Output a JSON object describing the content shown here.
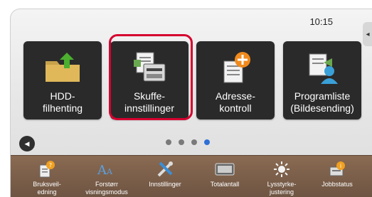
{
  "clock": "10:15",
  "tiles": [
    {
      "label": "HDD-\nfilhenting"
    },
    {
      "label": "Skuffe-\ninnstillinger"
    },
    {
      "label": "Adresse-\nkontroll"
    },
    {
      "label": "Programliste\n(Bildesending)"
    }
  ],
  "page_dots": {
    "count": 4,
    "active": 4
  },
  "bottom_bar": [
    {
      "label": "Bruksveil-\nedning"
    },
    {
      "label": "Forstørr\nvisningsmodus"
    },
    {
      "label": "Innstillinger"
    },
    {
      "label": "Totalantall"
    },
    {
      "label": "Lysstyrke-\njustering"
    },
    {
      "label": "Jobbstatus"
    }
  ]
}
